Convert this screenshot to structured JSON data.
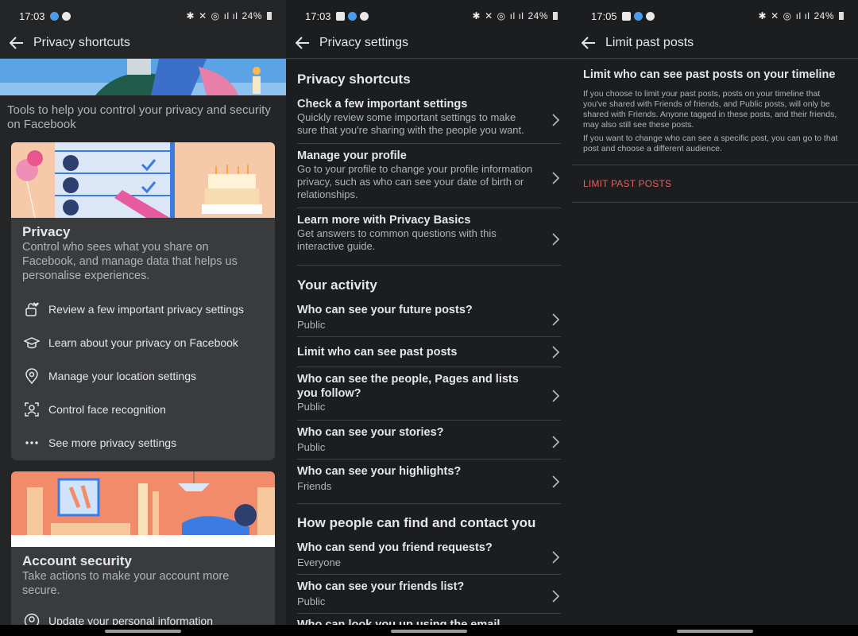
{
  "status": [
    {
      "time": "17:03",
      "battery": "24%"
    },
    {
      "time": "17:03",
      "battery": "24%"
    },
    {
      "time": "17:05",
      "battery": "24%"
    }
  ],
  "screen1": {
    "title": "Privacy shortcuts",
    "intro": "Tools to help you control your privacy and security on Facebook",
    "privacy_card": {
      "title": "Privacy",
      "desc": "Control who sees what you share on Facebook, and manage data that helps us personalise experiences.",
      "items": [
        {
          "label": "Review a few important privacy settings",
          "icon": "lock-heart-icon"
        },
        {
          "label": "Learn about your privacy on Facebook",
          "icon": "graduation-cap-icon"
        },
        {
          "label": "Manage your location settings",
          "icon": "location-pin-icon"
        },
        {
          "label": "Control face recognition",
          "icon": "face-recognition-icon"
        },
        {
          "label": "See more privacy settings",
          "icon": "more-dots-icon"
        }
      ]
    },
    "account_card": {
      "title": "Account security",
      "desc": "Take actions to make your account more secure.",
      "items": [
        {
          "label": "Update your personal information",
          "icon": "person-circle-icon"
        }
      ]
    }
  },
  "screen2": {
    "title": "Privacy settings",
    "sections": [
      {
        "title": "Privacy shortcuts"
      },
      {
        "title": "Your activity"
      },
      {
        "title": "How people can find and contact you"
      }
    ],
    "rows": [
      {
        "title": "Check a few important settings",
        "sub": "Quickly review some important settings to make sure that you're sharing with the people you want."
      },
      {
        "title": "Manage your profile",
        "sub": "Go to your profile to change your profile information privacy, such as who can see your date of birth or relationships."
      },
      {
        "title": "Learn more with Privacy Basics",
        "sub": "Get answers to common questions with this interactive guide."
      },
      {
        "title": "Who can see your future posts?",
        "sub": "Public"
      },
      {
        "title": "Limit who can see past posts",
        "sub": ""
      },
      {
        "title": "Who can see the people, Pages and lists you follow?",
        "sub": "Public"
      },
      {
        "title": "Who can see your stories?",
        "sub": "Public"
      },
      {
        "title": "Who can see your highlights?",
        "sub": "Friends"
      },
      {
        "title": "Who can send you friend requests?",
        "sub": "Everyone"
      },
      {
        "title": "Who can see your friends list?",
        "sub": "Public"
      },
      {
        "title": "Who can look you up using the email",
        "sub": ""
      }
    ]
  },
  "screen3": {
    "title": "Limit past posts",
    "heading": "Limit who can see past posts on your timeline",
    "para1": "If you choose to limit your past posts, posts on your timeline that you've shared with Friends of friends, and Public posts, will only be shared with Friends. Anyone tagged in these posts, and their friends, may also still see these posts.",
    "para2": "If you want to change who can see a specific post, you can go to that post and choose a different audience.",
    "action": "LIMIT PAST POSTS"
  },
  "colors": {
    "accent": "#e4605b",
    "bg": "#242526",
    "card": "#3a3b3c"
  }
}
